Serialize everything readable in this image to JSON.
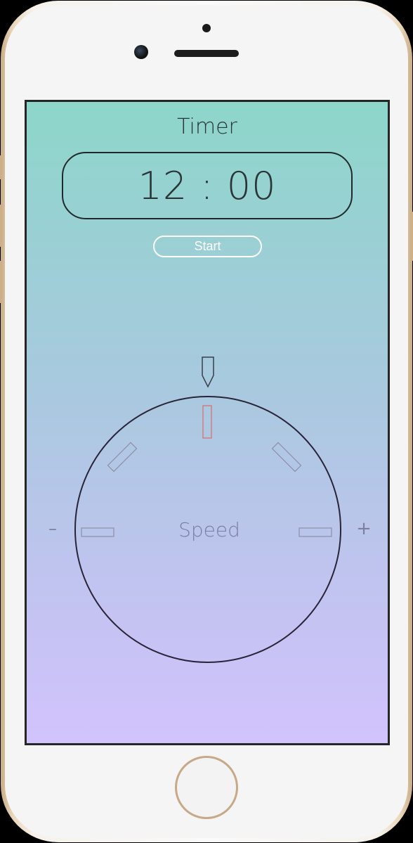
{
  "timer": {
    "title": "Timer",
    "value": "12 : 00"
  },
  "start_button": {
    "label": "Start"
  },
  "speed_dial": {
    "label": "Speed",
    "minus_label": "–",
    "plus_label": "+",
    "active_color": "#d96b6b",
    "inactive_color": "#8e8fa6"
  },
  "theme": {
    "gradient_top": "#8dd6ca",
    "gradient_bottom": "#d2c3fd",
    "text_color": "#2b3437"
  }
}
